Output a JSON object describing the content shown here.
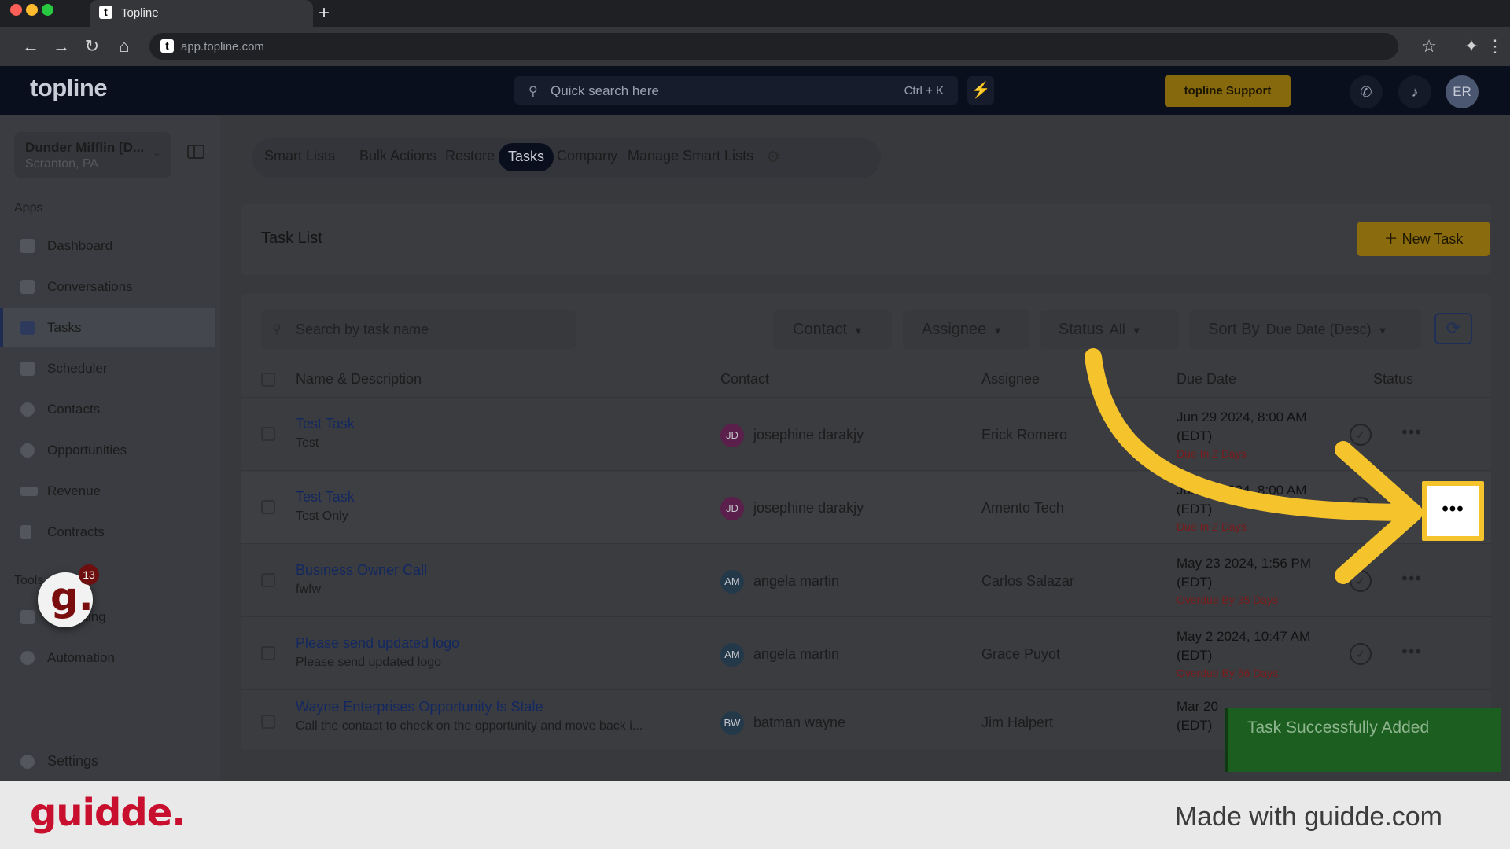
{
  "browser": {
    "tab_title": "Topline",
    "tab_icon": "t",
    "url": "app.topline.com",
    "traffic_colors": [
      "#ff5f57",
      "#febc2e",
      "#28c840"
    ]
  },
  "header": {
    "logo": "topline",
    "search_placeholder": "Quick search here",
    "search_shortcut": "Ctrl + K",
    "support_label": "topline Support",
    "avatar_initials": "ER"
  },
  "sidebar": {
    "org_name": "Dunder Mifflin [D...",
    "org_location": "Scranton, PA",
    "apps_label": "Apps",
    "apps": [
      {
        "label": "Dashboard",
        "icon": "dashboard-icon"
      },
      {
        "label": "Conversations",
        "icon": "chat-icon"
      },
      {
        "label": "Tasks",
        "icon": "tasks-icon",
        "active": true
      },
      {
        "label": "Scheduler",
        "icon": "calendar-icon"
      },
      {
        "label": "Contacts",
        "icon": "person-icon"
      },
      {
        "label": "Opportunities",
        "icon": "target-icon"
      },
      {
        "label": "Revenue",
        "icon": "card-icon"
      },
      {
        "label": "Contracts",
        "icon": "document-icon"
      }
    ],
    "tools_label": "Tools",
    "tools": [
      {
        "label": "Marketing",
        "icon": "megaphone-icon"
      },
      {
        "label": "Automation",
        "icon": "gears-icon"
      }
    ],
    "settings_label": "Settings",
    "guidde_badge_count": "13"
  },
  "page_tabs": [
    {
      "label": "Smart Lists"
    },
    {
      "label": "Bulk Actions"
    },
    {
      "label": "Restore"
    },
    {
      "label": "Tasks",
      "active": true
    },
    {
      "label": "Company"
    },
    {
      "label": "Manage Smart Lists"
    }
  ],
  "task_panel": {
    "title": "Task List",
    "new_task_label": "New Task"
  },
  "filters": {
    "search_placeholder": "Search by task name",
    "contact_label": "Contact",
    "assignee_label": "Assignee",
    "status_label": "Status",
    "status_value": "All",
    "sort_label": "Sort By",
    "sort_value": "Due Date (Desc)"
  },
  "table": {
    "headers": {
      "name": "Name & Description",
      "contact": "Contact",
      "assignee": "Assignee",
      "due": "Due Date",
      "status": "Status"
    },
    "rows": [
      {
        "name": "Test Task",
        "desc": "Test",
        "contact_initials": "JD",
        "contact_color": "#5a1f4a",
        "contact": "josephine darakjy",
        "assignee": "Erick Romero",
        "due_line1": "Jun 29 2024, 8:00 AM",
        "due_line2": "(EDT)",
        "due_note": "Due In 2 Days"
      },
      {
        "name": "Test Task",
        "desc": "Test Only",
        "contact_initials": "JD",
        "contact_color": "#5a1f4a",
        "contact": "josephine darakjy",
        "assignee": "Amento Tech",
        "due_line1": "Jun 29 2024, 8:00 AM",
        "due_line2": "(EDT)",
        "due_note": "Due In 2 Days"
      },
      {
        "name": "Business Owner Call",
        "desc": "fwfw",
        "contact_initials": "AM",
        "contact_color": "#23394a",
        "contact": "angela martin",
        "assignee": "Carlos Salazar",
        "due_line1": "May 23 2024, 1:56 PM",
        "due_line2": "(EDT)",
        "due_note": "Overdue By 35 Days"
      },
      {
        "name": "Please send updated logo",
        "desc": "Please send updated logo",
        "contact_initials": "AM",
        "contact_color": "#23394a",
        "contact": "angela martin",
        "assignee": "Grace Puyot",
        "due_line1": "May 2 2024, 10:47 AM",
        "due_line2": "(EDT)",
        "due_note": "Overdue By 56 Days"
      },
      {
        "name": "Wayne Enterprises Opportunity Is Stale",
        "desc": "Call the contact to check on the opportunity and move back i...",
        "contact_initials": "BW",
        "contact_color": "#23394a",
        "contact": "batman wayne",
        "assignee": "Jim Halpert",
        "due_line1": "Mar 20",
        "due_line2": "(EDT)",
        "due_note": ""
      }
    ]
  },
  "toast": {
    "text": "Task Successfully Added"
  },
  "highlight": {
    "dots": "•••"
  },
  "footer": {
    "logo": "guidde.",
    "made_with": "Made with guidde.com"
  },
  "colors": {
    "accent_yellow": "#f5c32b",
    "due_red": "#7a1a1a",
    "toast_green": "#1b5e20"
  }
}
